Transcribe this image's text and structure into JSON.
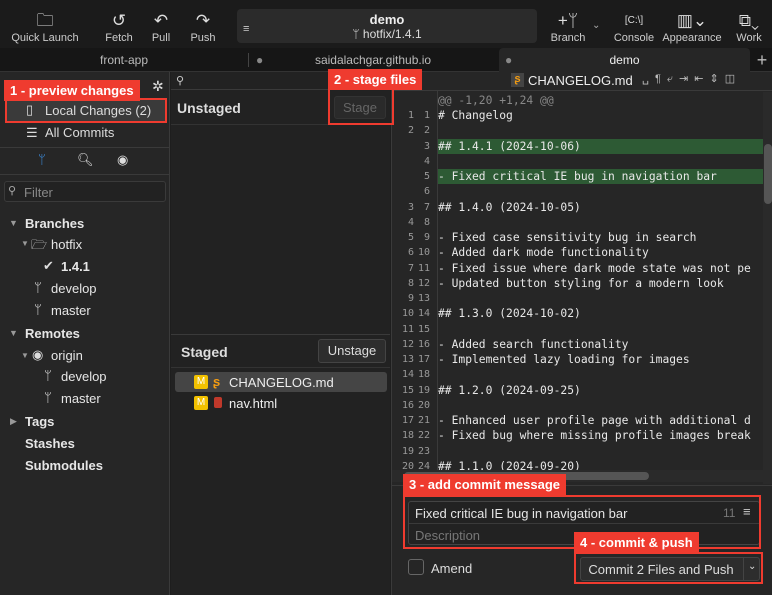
{
  "toolbar": {
    "quick_launch": "Quick Launch",
    "fetch": "Fetch",
    "pull": "Pull",
    "push": "Push",
    "repo_name": "demo",
    "branch": "hotfix/1.4.1",
    "branch_btn": "Branch",
    "console": "Console",
    "appearance": "Appearance",
    "work": "Work"
  },
  "tabs": [
    {
      "label": "front-app"
    },
    {
      "label": "saidalachgar.github.io"
    },
    {
      "label": "demo"
    }
  ],
  "sidebar": {
    "local_changes": "Local Changes (2)",
    "all_commits": "All Commits",
    "filter_placeholder": "Filter",
    "branches": "Branches",
    "hotfix": "hotfix",
    "current": "1.4.1",
    "develop": "develop",
    "master": "master",
    "remotes": "Remotes",
    "origin": "origin",
    "r_develop": "develop",
    "r_master": "master",
    "tags": "Tags",
    "stashes": "Stashes",
    "submodules": "Submodules"
  },
  "changes": {
    "unstaged": "Unstaged",
    "stage": "Stage",
    "staged": "Staged",
    "unstage": "Unstage",
    "files": [
      {
        "status": "M",
        "name": "CHANGELOG.md"
      },
      {
        "status": "M",
        "name": "nav.html"
      }
    ]
  },
  "diff": {
    "file": "CHANGELOG.md",
    "hunk": "@@ -1,20 +1,24 @@",
    "lines": [
      {
        "o": "1",
        "n": "1",
        "t": "# Changelog"
      },
      {
        "o": "2",
        "n": "2",
        "t": ""
      },
      {
        "o": "",
        "n": "3",
        "t": "## 1.4.1 (2024-10-06)",
        "add": true
      },
      {
        "o": "",
        "n": "4",
        "t": "",
        "add": true
      },
      {
        "o": "",
        "n": "5",
        "t": "- Fixed critical IE bug in navigation bar",
        "add": true
      },
      {
        "o": "",
        "n": "6",
        "t": "",
        "add": true
      },
      {
        "o": "3",
        "n": "7",
        "t": "## 1.4.0 (2024-10-05)"
      },
      {
        "o": "4",
        "n": "8",
        "t": ""
      },
      {
        "o": "5",
        "n": "9",
        "t": "- Fixed case sensitivity bug in search"
      },
      {
        "o": "6",
        "n": "10",
        "t": "- Added dark mode functionality"
      },
      {
        "o": "7",
        "n": "11",
        "t": "- Fixed issue where dark mode state was not pe"
      },
      {
        "o": "8",
        "n": "12",
        "t": "- Updated button styling for a modern look"
      },
      {
        "o": "9",
        "n": "13",
        "t": ""
      },
      {
        "o": "10",
        "n": "14",
        "t": "## 1.3.0 (2024-10-02)"
      },
      {
        "o": "11",
        "n": "15",
        "t": ""
      },
      {
        "o": "12",
        "n": "16",
        "t": "- Added search functionality"
      },
      {
        "o": "13",
        "n": "17",
        "t": "- Implemented lazy loading for images"
      },
      {
        "o": "14",
        "n": "18",
        "t": ""
      },
      {
        "o": "15",
        "n": "19",
        "t": "## 1.2.0 (2024-09-25)"
      },
      {
        "o": "16",
        "n": "20",
        "t": ""
      },
      {
        "o": "17",
        "n": "21",
        "t": "- Enhanced user profile page with additional d"
      },
      {
        "o": "18",
        "n": "22",
        "t": "- Fixed bug where missing profile images break"
      },
      {
        "o": "19",
        "n": "23",
        "t": ""
      },
      {
        "o": "20",
        "n": "24",
        "t": "## 1.1.0 (2024-09-20)"
      }
    ]
  },
  "commit": {
    "summary": "Fixed critical IE bug in navigation bar",
    "char_count": "11",
    "description_placeholder": "Description",
    "amend": "Amend",
    "button": "Commit 2 Files and Push"
  },
  "annotations": [
    "1 - preview changes",
    "2 - stage files",
    "3 - add commit message",
    "4 - commit & push"
  ]
}
